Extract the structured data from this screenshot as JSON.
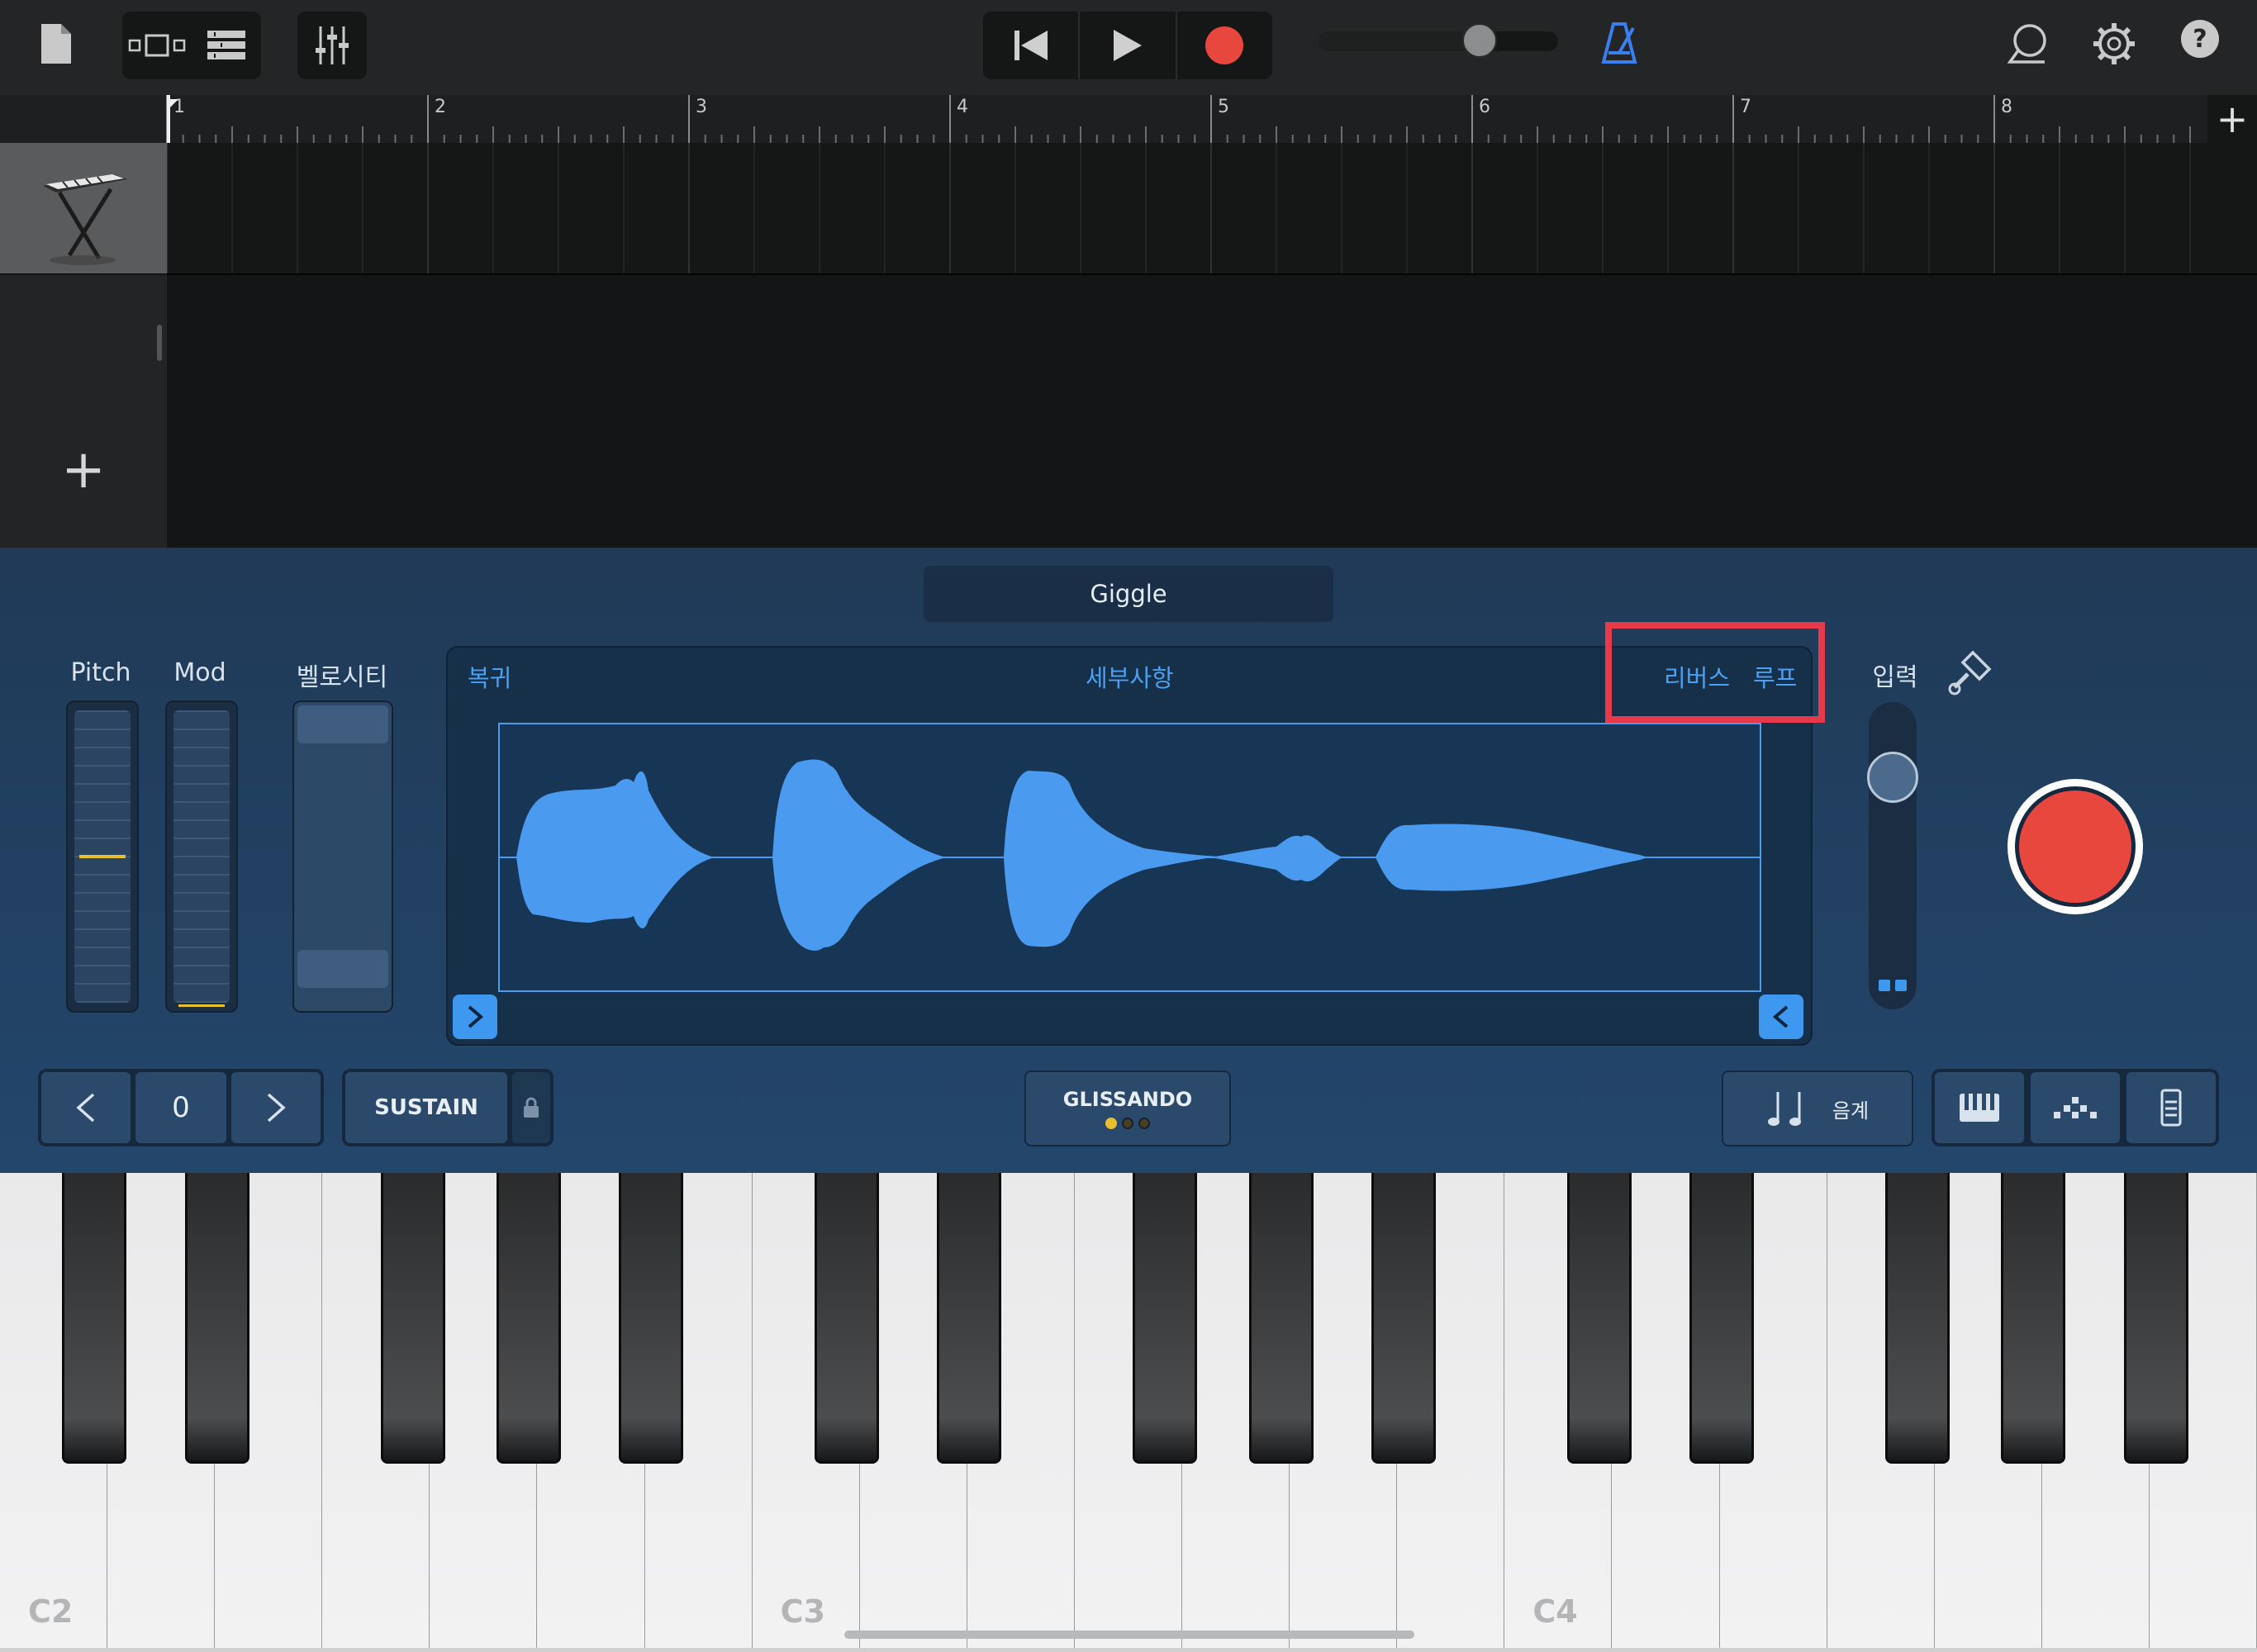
{
  "toolbar": {
    "icons": [
      "document-icon",
      "view-switch-icon",
      "tracks-view-icon",
      "mixer-icon",
      "go-to-start-icon",
      "play-icon",
      "record-icon",
      "master-volume-slider",
      "metronome-icon",
      "loop-browser-icon",
      "settings-gear-icon",
      "help-icon"
    ],
    "help_label": "?",
    "accent_color": "#3a7ff0",
    "record_color": "#e8473d",
    "master_volume": 0.7
  },
  "ruler": {
    "bars": [
      "1",
      "2",
      "3",
      "4",
      "5",
      "6",
      "7",
      "8"
    ],
    "add_section_label": "+"
  },
  "tracks": {
    "add_track_label": "+"
  },
  "instrument": {
    "patch_name": "Giggle",
    "pitch_label": "Pitch",
    "mod_label": "Mod",
    "velocity_label": "벨로시티",
    "sampler": {
      "revert_label": "복귀",
      "details_label": "세부사항",
      "reverse_label": "리버스",
      "loop_label": "루프"
    },
    "input_label": "입력",
    "input_level": 0.8
  },
  "controls": {
    "octave_value": "0",
    "sustain_label": "SUSTAIN",
    "glissando_label": "GLISSANDO",
    "scale_label": "음계"
  },
  "keyboard": {
    "octave_labels": [
      "C2",
      "C3",
      "C4"
    ]
  }
}
